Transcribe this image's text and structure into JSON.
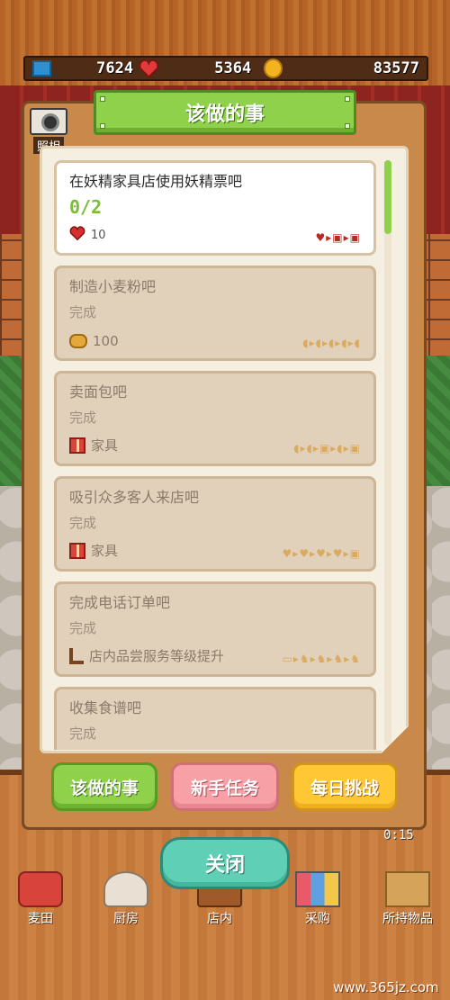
{
  "resources": {
    "tickets": "7624",
    "hearts": "5364",
    "coins": "83577"
  },
  "photo": {
    "label": "照相"
  },
  "panel": {
    "title": "该做的事"
  },
  "tasks": [
    {
      "title": "在妖精家具店使用妖精票吧",
      "status": "0/2",
      "reward_icon": "heart-icon",
      "reward": "10",
      "progress": "♥▸▣▸▣",
      "active": true
    },
    {
      "title": "制造小麦粉吧",
      "status": "完成",
      "reward_icon": "bread-icon",
      "reward": "100",
      "progress": "◖▸◖▸◖▸◖▸◖",
      "active": false
    },
    {
      "title": "卖面包吧",
      "status": "完成",
      "reward_icon": "gift-icon",
      "reward": "家具",
      "progress": "◖▸◖▸▣▸◖▸▣",
      "active": false
    },
    {
      "title": "吸引众多客人来店吧",
      "status": "完成",
      "reward_icon": "gift-icon",
      "reward": "家具",
      "progress": "♥▸♥▸♥▸♥▸▣",
      "active": false
    },
    {
      "title": "完成电话订单吧",
      "status": "完成",
      "reward_icon": "chair-icon",
      "reward": "店内品尝服务等级提升",
      "progress": "▭▸♞▸♞▸♞▸♞",
      "active": false
    },
    {
      "title": "收集食谱吧",
      "status": "完成",
      "reward_icon": "",
      "reward": "",
      "progress": "",
      "active": false
    }
  ],
  "tabs": {
    "todo": "该做的事",
    "newbie": "新手任务",
    "daily": "每日挑战"
  },
  "close_label": "关闭",
  "timer": "0:15",
  "nav": {
    "wheat": "麦田",
    "kitchen": "厨房",
    "store": "店内",
    "purchase": "采购",
    "items": "所持物品"
  },
  "watermark": "www.365jz.com",
  "colors": {
    "accent_green": "#8fd14a",
    "accent_pink": "#f7a0a6",
    "accent_yellow": "#ffc733",
    "accent_teal": "#5fd0b5"
  }
}
